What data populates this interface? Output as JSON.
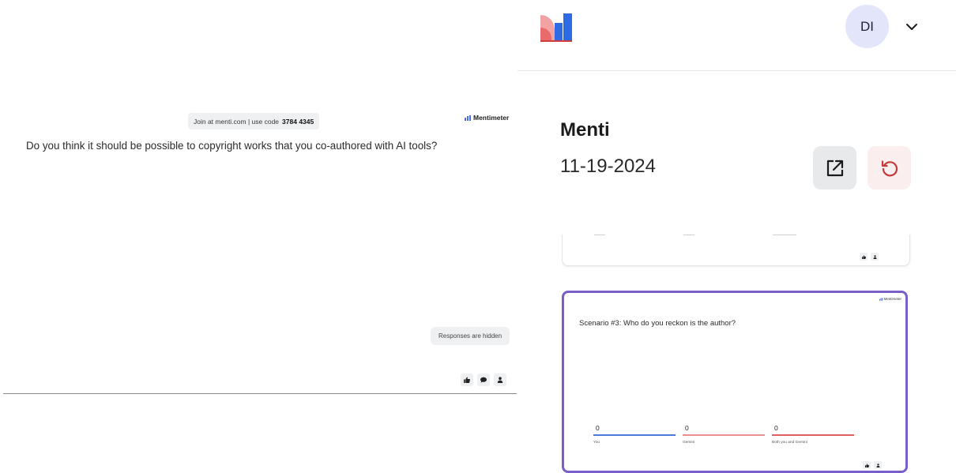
{
  "slide": {
    "join_text": "Join at menti.com | use code",
    "join_code": "3784 4345",
    "brand": "Mentimeter",
    "question": "Do you think it should be possible to copyright works that you co-authored with AI tools?",
    "responses_status": "Responses are hidden",
    "reaction_icons": [
      "thumbs-up-icon",
      "comment-icon",
      "person-icon"
    ]
  },
  "header": {
    "avatar_initials": "DI"
  },
  "presentation": {
    "title": "Menti",
    "date": "11-19-2024"
  },
  "current_slide": {
    "brand": "Mentimeter",
    "question": "Scenario #3: Who do you reckon is the author?",
    "options": [
      {
        "label": "You",
        "count": "0",
        "color": "#4a7bdc"
      },
      {
        "label": "Gemini",
        "count": "0",
        "color": "#e8908f"
      },
      {
        "label": "Both you and Gemini",
        "count": "0",
        "color": "#e06060"
      }
    ]
  },
  "colors": {
    "accent_border": "#7a5ec9",
    "share_bg": "#e8e9eb",
    "reset_bg": "#fbeeee",
    "reset_icon": "#c23a3a"
  }
}
